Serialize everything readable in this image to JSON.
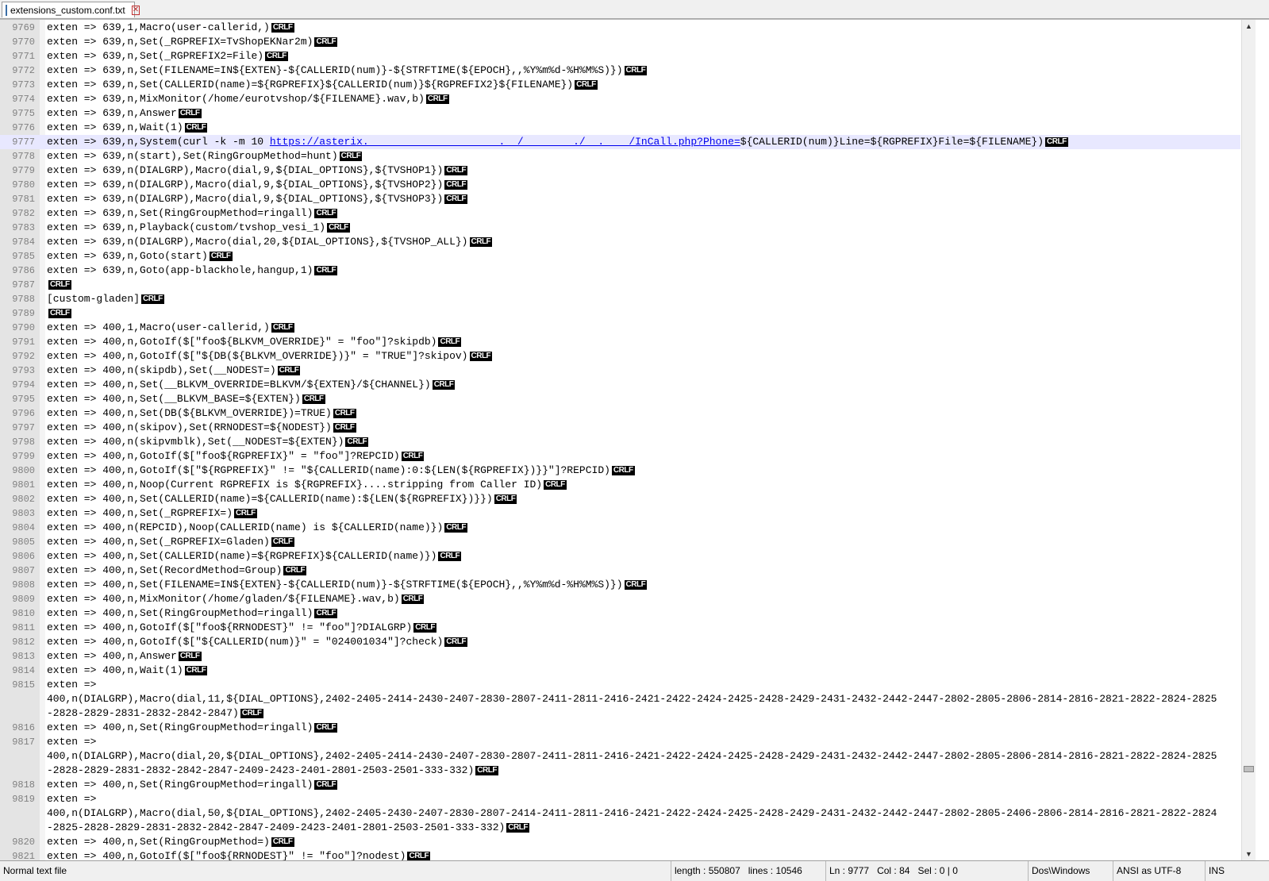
{
  "tab": {
    "title": "extensions_custom.conf.txt",
    "close_glyph": "✕"
  },
  "current_line": "9777",
  "eol_marker": "CRLF",
  "lines": [
    {
      "n": "9769",
      "text": "exten => 639,1,Macro(user-callerid,)",
      "eol": true
    },
    {
      "n": "9770",
      "text": "exten => 639,n,Set(_RGPREFIX=TvShopEKNar2m)",
      "eol": true
    },
    {
      "n": "9771",
      "text": "exten => 639,n,Set(_RGPREFIX2=File)",
      "eol": true
    },
    {
      "n": "9772",
      "text": "exten => 639,n,Set(FILENAME=IN${EXTEN}-${CALLERID(num)}-${STRFTIME(${EPOCH},,%Y%m%d-%H%M%S)})",
      "eol": true
    },
    {
      "n": "9773",
      "text": "exten => 639,n,Set(CALLERID(name)=${RGPREFIX}${CALLERID(num)}${RGPREFIX2}${FILENAME})",
      "eol": true
    },
    {
      "n": "9774",
      "text": "exten => 639,n,MixMonitor(/home/eurotvshop/${FILENAME}.wav,b)",
      "eol": true
    },
    {
      "n": "9775",
      "text": "exten => 639,n,Answer",
      "eol": true
    },
    {
      "n": "9776",
      "text": "exten => 639,n,Wait(1)",
      "eol": true
    },
    {
      "n": "9777",
      "text": "exten => 639,n,System(curl -k -m 10 ",
      "link": "https://asterix.                     .__/        ./  .    /InCall.php?Phone=",
      "after": "${CALLERID(num)}Line=${RGPREFIX}File=${FILENAME})",
      "eol": true
    },
    {
      "n": "9778",
      "text": "exten => 639,n(start),Set(RingGroupMethod=hunt)",
      "eol": true
    },
    {
      "n": "9779",
      "text": "exten => 639,n(DIALGRP),Macro(dial,9,${DIAL_OPTIONS},${TVSHOP1})",
      "eol": true
    },
    {
      "n": "9780",
      "text": "exten => 639,n(DIALGRP),Macro(dial,9,${DIAL_OPTIONS},${TVSHOP2})",
      "eol": true
    },
    {
      "n": "9781",
      "text": "exten => 639,n(DIALGRP),Macro(dial,9,${DIAL_OPTIONS},${TVSHOP3})",
      "eol": true
    },
    {
      "n": "9782",
      "text": "exten => 639,n,Set(RingGroupMethod=ringall)",
      "eol": true
    },
    {
      "n": "9783",
      "text": "exten => 639,n,Playback(custom/tvshop_vesi_1)",
      "eol": true
    },
    {
      "n": "9784",
      "text": "exten => 639,n(DIALGRP),Macro(dial,20,${DIAL_OPTIONS},${TVSHOP_ALL})",
      "eol": true
    },
    {
      "n": "9785",
      "text": "exten => 639,n,Goto(start)",
      "eol": true
    },
    {
      "n": "9786",
      "text": "exten => 639,n,Goto(app-blackhole,hangup,1)",
      "eol": true
    },
    {
      "n": "9787",
      "text": "",
      "eol": true
    },
    {
      "n": "9788",
      "text": "[custom-gladen]",
      "eol": true
    },
    {
      "n": "9789",
      "text": "",
      "eol": true
    },
    {
      "n": "9790",
      "text": "exten => 400,1,Macro(user-callerid,)",
      "eol": true
    },
    {
      "n": "9791",
      "text": "exten => 400,n,GotoIf($[\"foo${BLKVM_OVERRIDE}\" = \"foo\"]?skipdb)",
      "eol": true
    },
    {
      "n": "9792",
      "text": "exten => 400,n,GotoIf($[\"${DB(${BLKVM_OVERRIDE})}\" = \"TRUE\"]?skipov)",
      "eol": true
    },
    {
      "n": "9793",
      "text": "exten => 400,n(skipdb),Set(__NODEST=)",
      "eol": true
    },
    {
      "n": "9794",
      "text": "exten => 400,n,Set(__BLKVM_OVERRIDE=BLKVM/${EXTEN}/${CHANNEL})",
      "eol": true
    },
    {
      "n": "9795",
      "text": "exten => 400,n,Set(__BLKVM_BASE=${EXTEN})",
      "eol": true
    },
    {
      "n": "9796",
      "text": "exten => 400,n,Set(DB(${BLKVM_OVERRIDE})=TRUE)",
      "eol": true
    },
    {
      "n": "9797",
      "text": "exten => 400,n(skipov),Set(RRNODEST=${NODEST})",
      "eol": true
    },
    {
      "n": "9798",
      "text": "exten => 400,n(skipvmblk),Set(__NODEST=${EXTEN})",
      "eol": true
    },
    {
      "n": "9799",
      "text": "exten => 400,n,GotoIf($[\"foo${RGPREFIX}\" = \"foo\"]?REPCID)",
      "eol": true
    },
    {
      "n": "9800",
      "text": "exten => 400,n,GotoIf($[\"${RGPREFIX}\" != \"${CALLERID(name):0:${LEN(${RGPREFIX})}}\"]?REPCID)",
      "eol": true
    },
    {
      "n": "9801",
      "text": "exten => 400,n,Noop(Current RGPREFIX is ${RGPREFIX}....stripping from Caller ID)",
      "eol": true
    },
    {
      "n": "9802",
      "text": "exten => 400,n,Set(CALLERID(name)=${CALLERID(name):${LEN(${RGPREFIX})}})",
      "eol": true
    },
    {
      "n": "9803",
      "text": "exten => 400,n,Set(_RGPREFIX=)",
      "eol": true
    },
    {
      "n": "9804",
      "text": "exten => 400,n(REPCID),Noop(CALLERID(name) is ${CALLERID(name)})",
      "eol": true
    },
    {
      "n": "9805",
      "text": "exten => 400,n,Set(_RGPREFIX=Gladen)",
      "eol": true
    },
    {
      "n": "9806",
      "text": "exten => 400,n,Set(CALLERID(name)=${RGPREFIX}${CALLERID(name)})",
      "eol": true
    },
    {
      "n": "9807",
      "text": "exten => 400,n,Set(RecordMethod=Group)",
      "eol": true
    },
    {
      "n": "9808",
      "text": "exten => 400,n,Set(FILENAME=IN${EXTEN}-${CALLERID(num)}-${STRFTIME(${EPOCH},,%Y%m%d-%H%M%S)})",
      "eol": true
    },
    {
      "n": "9809",
      "text": "exten => 400,n,MixMonitor(/home/gladen/${FILENAME}.wav,b)",
      "eol": true
    },
    {
      "n": "9810",
      "text": "exten => 400,n,Set(RingGroupMethod=ringall)",
      "eol": true
    },
    {
      "n": "9811",
      "text": "exten => 400,n,GotoIf($[\"foo${RRNODEST}\" != \"foo\"]?DIALGRP)",
      "eol": true
    },
    {
      "n": "9812",
      "text": "exten => 400,n,GotoIf($[\"${CALLERID(num)}\" = \"024001034\"]?check)",
      "eol": true
    },
    {
      "n": "9813",
      "text": "exten => 400,n,Answer",
      "eol": true
    },
    {
      "n": "9814",
      "text": "exten => 400,n,Wait(1)",
      "eol": true
    },
    {
      "n": "9815",
      "text": "exten =>",
      "eol": false
    },
    {
      "n": "",
      "text": "400,n(DIALGRP),Macro(dial,11,${DIAL_OPTIONS},2402-2405-2414-2430-2407-2830-2807-2411-2811-2416-2421-2422-2424-2425-2428-2429-2431-2432-2442-2447-2802-2805-2806-2814-2816-2821-2822-2824-2825",
      "eol": false
    },
    {
      "n": "",
      "text": "-2828-2829-2831-2832-2842-2847)",
      "eol": true
    },
    {
      "n": "9816",
      "text": "exten => 400,n,Set(RingGroupMethod=ringall)",
      "eol": true
    },
    {
      "n": "9817",
      "text": "exten =>",
      "eol": false
    },
    {
      "n": "",
      "text": "400,n(DIALGRP),Macro(dial,20,${DIAL_OPTIONS},2402-2405-2414-2430-2407-2830-2807-2411-2811-2416-2421-2422-2424-2425-2428-2429-2431-2432-2442-2447-2802-2805-2806-2814-2816-2821-2822-2824-2825",
      "eol": false
    },
    {
      "n": "",
      "text": "-2828-2829-2831-2832-2842-2847-2409-2423-2401-2801-2503-2501-333-332)",
      "eol": true
    },
    {
      "n": "9818",
      "text": "exten => 400,n,Set(RingGroupMethod=ringall)",
      "eol": true
    },
    {
      "n": "9819",
      "text": "exten =>",
      "eol": false
    },
    {
      "n": "",
      "text": "400,n(DIALGRP),Macro(dial,50,${DIAL_OPTIONS},2402-2405-2430-2407-2830-2807-2414-2411-2811-2416-2421-2422-2424-2425-2428-2429-2431-2432-2442-2447-2802-2805-2406-2806-2814-2816-2821-2822-2824",
      "eol": false
    },
    {
      "n": "",
      "text": "-2825-2828-2829-2831-2832-2842-2847-2409-2423-2401-2801-2503-2501-333-332)",
      "eol": true
    },
    {
      "n": "9820",
      "text": "exten => 400,n,Set(RingGroupMethod=)",
      "eol": true
    },
    {
      "n": "9821",
      "text": "exten => 400,n,GotoIf($[\"foo${RRNODEST}\" != \"foo\"]?nodest)",
      "eol": true
    }
  ],
  "status": {
    "file_type": "Normal text file",
    "length": "length : 550807",
    "lines": "lines : 10546",
    "ln": "Ln : 9777",
    "col": "Col : 84",
    "sel": "Sel : 0 | 0",
    "eol_format": "Dos\\Windows",
    "encoding": "ANSI as UTF-8",
    "mode": "INS"
  }
}
